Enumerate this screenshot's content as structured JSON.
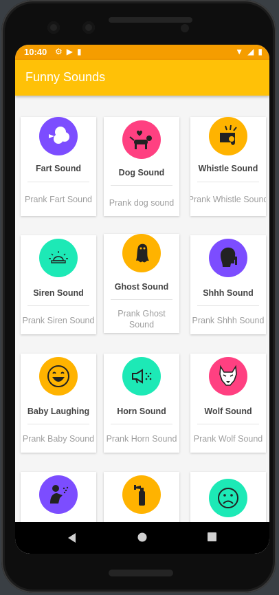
{
  "status_bar": {
    "time": "10:40"
  },
  "app_bar": {
    "title": "Funny Sounds"
  },
  "colors": {
    "status_bar": "#f59d00",
    "app_bar": "#ffc107",
    "purple": "#7c4dff",
    "pink": "#ff4081",
    "amber": "#ffb300",
    "teal": "#1de9b6"
  },
  "cards": [
    {
      "title": "Fart Sound",
      "subtitle": "Prank Fart Sound",
      "icon": "fart-icon"
    },
    {
      "title": "Dog Sound",
      "subtitle": "Prank dog sound",
      "icon": "dog-icon"
    },
    {
      "title": "Whistle Sound",
      "subtitle": "Prank Whistle Sound",
      "icon": "whistle-icon"
    },
    {
      "title": "Siren Sound",
      "subtitle": "Prank Siren Sound",
      "icon": "siren-icon"
    },
    {
      "title": "Ghost Sound",
      "subtitle": "Prank Ghost Sound",
      "icon": "ghost-icon"
    },
    {
      "title": "Shhh Sound",
      "subtitle": "Prank Shhh Sound",
      "icon": "shhh-icon"
    },
    {
      "title": "Baby Laughing",
      "subtitle": "Prank Baby Sound",
      "icon": "laughing-face-icon"
    },
    {
      "title": "Horn Sound",
      "subtitle": "Prank Horn Sound",
      "icon": "horn-icon"
    },
    {
      "title": "Wolf Sound",
      "subtitle": "Prank Wolf Sound",
      "icon": "wolf-icon"
    },
    {
      "title": "",
      "subtitle": "",
      "icon": "sneeze-icon"
    },
    {
      "title": "",
      "subtitle": "",
      "icon": "air-horn-icon"
    },
    {
      "title": "",
      "subtitle": "",
      "icon": "sad-face-icon"
    }
  ],
  "nav": {
    "back": "back-icon",
    "home": "home-icon",
    "recents": "recents-icon"
  }
}
